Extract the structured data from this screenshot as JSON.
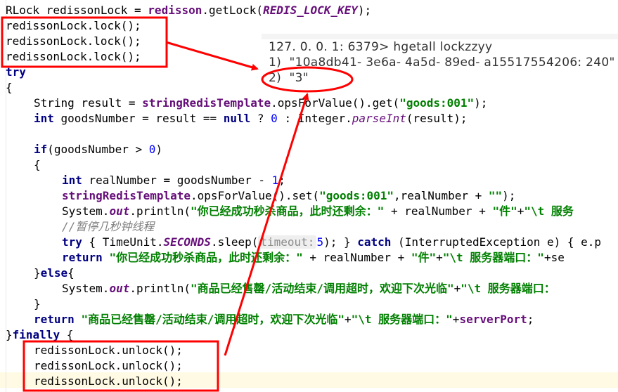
{
  "code": {
    "line_get_lock": {
      "a": "RLock redissonLock = ",
      "b": "redisson",
      "c": ".getLock(",
      "d": "REDIS_LOCK_KEY",
      "e": ");"
    },
    "lock_call": "redissonLock.lock();",
    "kw_try": "try",
    "brace_open": "{",
    "brace_close": "}",
    "line_result": {
      "a": "String result = ",
      "b": "stringRedisTemplate",
      "c": ".opsForValue().get(",
      "d": "\"goods:001\"",
      "e": ");"
    },
    "line_goods": {
      "a": "int",
      "b": " goodsNumber = result == ",
      "c": "null",
      "d": " ? ",
      "e": "0",
      "f": " : Integer.",
      "g": "parseInt",
      "h": "(result);"
    },
    "line_if": {
      "a": "if",
      "b": "(goodsNumber > ",
      "c": "0",
      "d": ")"
    },
    "line_real": {
      "a": "int",
      "b": " realNumber = goodsNumber - ",
      "c": "1",
      "d": ";"
    },
    "line_set": {
      "a": "stringRedisTemplate",
      "b": ".opsForValue().set(",
      "c": "\"goods:001\"",
      "d": ",realNumber + ",
      "e": "\"\"",
      "f": ");"
    },
    "line_print1": {
      "a": "System.",
      "b": "out",
      "c": ".println(",
      "d": "\"你已经成功秒杀商品，此时还剩余：\"",
      "e": " + realNumber + ",
      "f": "\"件\"",
      "g": "+",
      "h": "\"\\t 服务"
    },
    "line_comment": "//暂停几秒钟线程",
    "line_sleep": {
      "a": "try",
      "b": " { TimeUnit.",
      "c": "SECONDS",
      "d": ".sleep(",
      "hint": "timeout:",
      "e": "5",
      "f": "); } ",
      "g": "catch",
      "h": " (InterruptedException e) { e.p"
    },
    "line_return1": {
      "a": "return",
      "b": " ",
      "c": "\"你已经成功秒杀商品，此时还剩余：\"",
      "d": " + realNumber + ",
      "e": "\"件\"",
      "f": "+",
      "g": "\"\\t 服务器端口：\"",
      "h": "+se"
    },
    "line_else": {
      "a": "}",
      "b": "else",
      "c": "{"
    },
    "line_print2": {
      "a": "System.",
      "b": "out",
      "c": ".println(",
      "d": "\"商品已经售罄/活动结束/调用超时，欢迎下次光临\"",
      "e": "+",
      "f": "\"\\t 服务器端口："
    },
    "line_return2": {
      "a": "return",
      "b": " ",
      "c": "\"商品已经售罄/活动结束/调用超时，欢迎下次光临\"",
      "d": "+",
      "e": "\"\\t 服务器端口：\"",
      "f": "+",
      "g": "serverPort",
      "h": ";"
    },
    "line_finally": {
      "a": "}",
      "b": "finally",
      "c": " {"
    },
    "unlock_call": "redissonLock.unlock();"
  },
  "redis_cli": {
    "prompt": "127. 0. 0. 1: 6379> hgetall lockzzyy",
    "row1": "1)  \"10a8db41- 3e6a- 4a5d- 89ed- a15517554206: 240\"",
    "row2": "2)  \"3\""
  },
  "colors": {
    "annotation": "#ff0000"
  }
}
